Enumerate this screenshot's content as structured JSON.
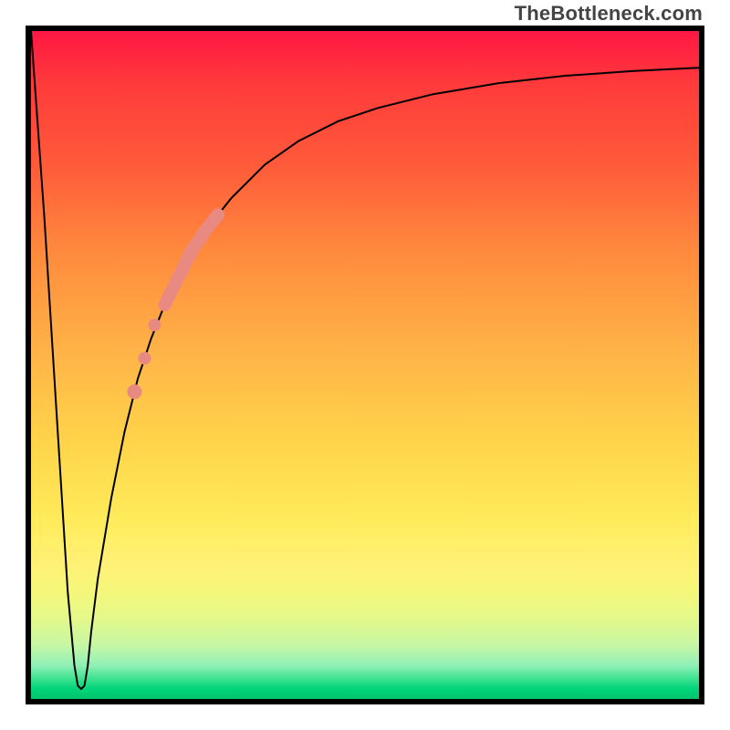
{
  "watermark_text": "TheBottleneck.com",
  "chart_data": {
    "type": "line",
    "title": "",
    "xlabel": "",
    "ylabel": "",
    "xlim": [
      0,
      100
    ],
    "ylim": [
      0,
      100
    ],
    "grid": false,
    "background_gradient": {
      "top_color": "#ff1744",
      "bottom_color": "#00c46a",
      "description": "vertical gradient red → orange → yellow → green"
    },
    "series": [
      {
        "name": "bottleneck-curve",
        "color": "#000000",
        "stroke_width": 2,
        "x": [
          0,
          2,
          4,
          5.5,
          6.5,
          7,
          7.5,
          8,
          8.5,
          9,
          10,
          12,
          14,
          16,
          18,
          20,
          23,
          26,
          30,
          35,
          40,
          46,
          52,
          60,
          70,
          80,
          90,
          100
        ],
        "y": [
          100,
          72,
          40,
          16,
          5,
          2,
          1.5,
          2,
          5,
          10,
          18,
          30,
          40,
          48,
          54,
          59,
          65,
          70,
          75,
          80,
          83.5,
          86.5,
          88.5,
          90.5,
          92.2,
          93.3,
          94,
          94.5
        ]
      }
    ],
    "overlays": [
      {
        "name": "highlight-band",
        "description": "thick salmon segment along curve",
        "color": "#e88a82",
        "stroke_width": 14,
        "x": [
          20,
          22,
          24,
          26,
          28
        ],
        "y": [
          59,
          63,
          67,
          70,
          72.5
        ]
      },
      {
        "name": "highlight-dot-1",
        "type": "scatter",
        "color": "#e88a82",
        "radius": 7,
        "x": [
          18.5
        ],
        "y": [
          56
        ]
      },
      {
        "name": "highlight-dot-2",
        "type": "scatter",
        "color": "#e88a82",
        "radius": 7,
        "x": [
          17
        ],
        "y": [
          51
        ]
      },
      {
        "name": "highlight-dot-3",
        "type": "scatter",
        "color": "#e88a82",
        "radius": 8,
        "x": [
          15.5
        ],
        "y": [
          46
        ]
      }
    ]
  }
}
